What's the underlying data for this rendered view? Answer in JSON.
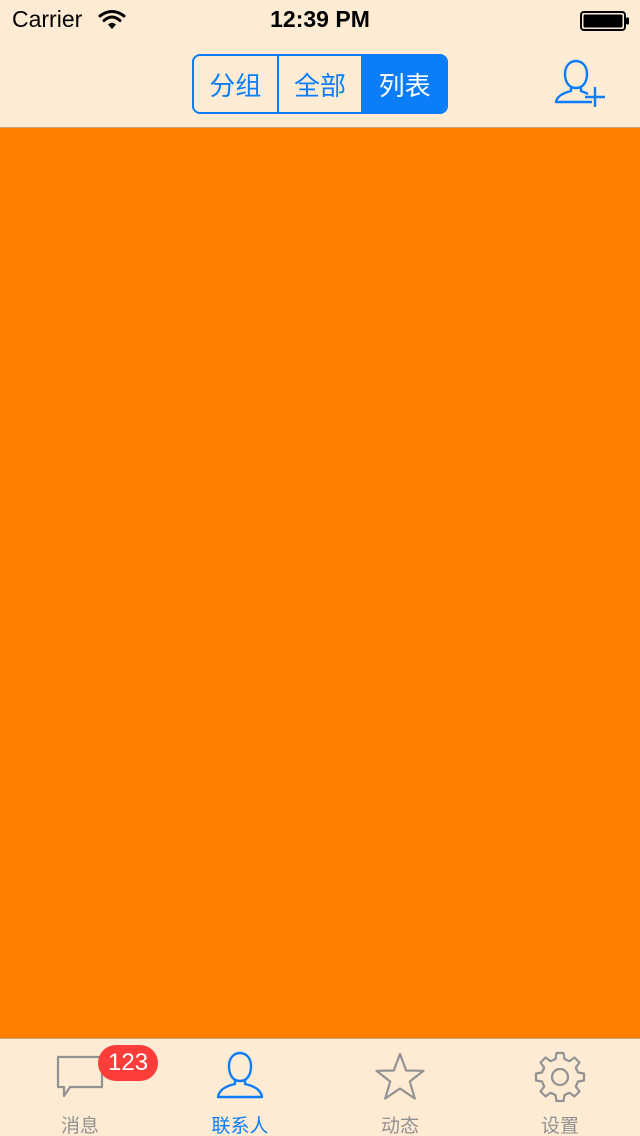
{
  "status_bar": {
    "carrier": "Carrier",
    "time": "12:39 PM",
    "wifi_icon": "wifi-icon",
    "battery_icon": "battery-full-icon"
  },
  "nav": {
    "segments": [
      {
        "label": "分组",
        "selected": false
      },
      {
        "label": "全部",
        "selected": false
      },
      {
        "label": "列表",
        "selected": true
      }
    ],
    "add_contact_icon": "add-contact-icon"
  },
  "content": {
    "background_color": "#ff7f00"
  },
  "tabbar": {
    "tabs": [
      {
        "label": "消息",
        "icon": "message-bubble-icon",
        "badge": "123",
        "active": false
      },
      {
        "label": "联系人",
        "icon": "person-icon",
        "active": true
      },
      {
        "label": "动态",
        "icon": "star-icon",
        "active": false
      },
      {
        "label": "设置",
        "icon": "gear-icon",
        "active": false
      }
    ]
  },
  "colors": {
    "accent": "#0a7df7",
    "bar_background": "#fdebd3",
    "inactive": "#929292",
    "badge": "#fc3d39"
  }
}
